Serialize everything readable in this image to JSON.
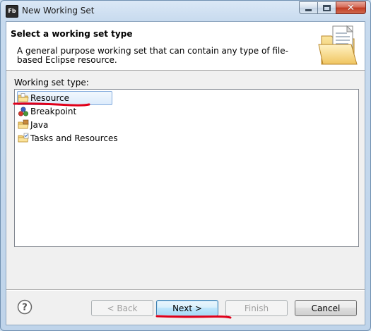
{
  "window": {
    "title": "New Working Set",
    "app_icon_text": "Fb",
    "close_glyph": "✕"
  },
  "banner": {
    "title": "Select a working set type",
    "description": "A general purpose working set that can contain any type of file-based Eclipse resource.",
    "icon": "folder-with-document-icon"
  },
  "tree": {
    "label": "Working set type:",
    "items": [
      {
        "label": "Resource",
        "icon": "resource-folder-icon",
        "selected": true
      },
      {
        "label": "Breakpoint",
        "icon": "breakpoint-icon",
        "selected": false
      },
      {
        "label": "Java",
        "icon": "java-package-folder-icon",
        "selected": false
      },
      {
        "label": "Tasks and Resources",
        "icon": "tasks-resources-icon",
        "selected": false
      }
    ]
  },
  "buttons": {
    "help": "?",
    "back": "< Back",
    "next": "Next >",
    "finish": "Finish",
    "cancel": "Cancel"
  },
  "colors": {
    "annotation_red": "#e0001a",
    "selection_border": "#84acdd",
    "default_button_border": "#3c7fb1"
  }
}
